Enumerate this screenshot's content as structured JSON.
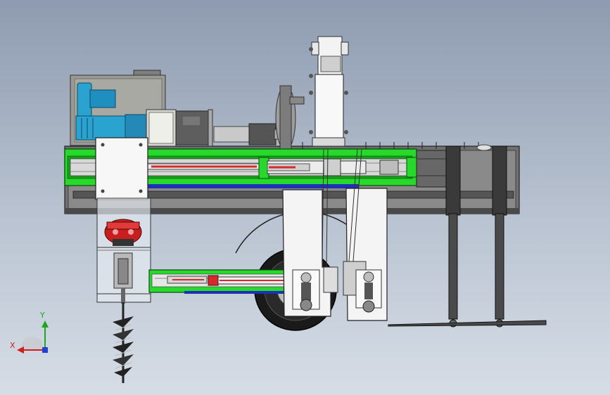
{
  "viewport": {
    "background_top": "#8e9bb0",
    "background_bottom": "#d6dde6"
  },
  "colors": {
    "frame_green": "#27d92a",
    "frame_dark": "#1b1b1b",
    "motor_blue": "#2aa3d0",
    "engine_red": "#c81e1e",
    "rod_red": "#d62a2a",
    "chassis_gray": "#6d6d6d",
    "panel_white": "#f4f4f4",
    "accent_blue": "#1f2fb8"
  },
  "triad": {
    "x_label": "X",
    "y_label": "Y",
    "x_color": "#d21d1d",
    "y_color": "#1fa51f",
    "z_color": "#2040d0",
    "icon": "coordinate-triad-icon"
  }
}
